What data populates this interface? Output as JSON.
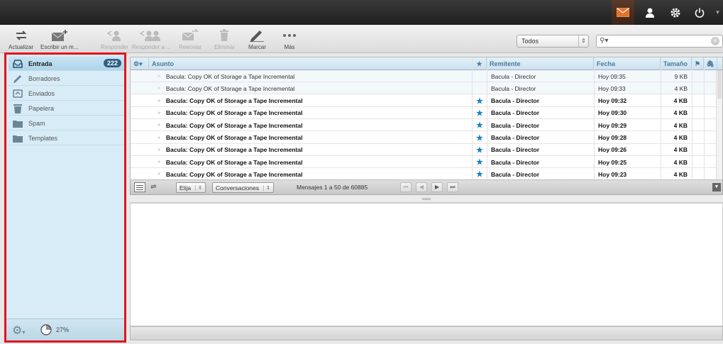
{
  "topbar": {
    "icons": [
      "mail-icon",
      "user-icon",
      "gear-icon",
      "power-icon"
    ],
    "menu_arrow": "▾"
  },
  "toolbar": {
    "buttons": [
      {
        "label": "Actualizar",
        "icon": "refresh-icon",
        "enabled": true
      },
      {
        "label": "Escribir un m...",
        "icon": "compose-icon",
        "enabled": true
      },
      {
        "label": "Responder",
        "icon": "reply-icon",
        "enabled": false
      },
      {
        "label": "Responder a ...",
        "icon": "reply-all-icon",
        "enabled": false
      },
      {
        "label": "Reenviar",
        "icon": "forward-icon",
        "enabled": false
      },
      {
        "label": "Eliminar",
        "icon": "trash-icon",
        "enabled": false
      },
      {
        "label": "Marcar",
        "icon": "mark-icon",
        "enabled": true
      },
      {
        "label": "Más",
        "icon": "more-icon",
        "enabled": true
      }
    ],
    "filter": {
      "value": "Todos"
    },
    "search": {
      "placeholder": "",
      "value": ""
    }
  },
  "folders": {
    "items": [
      {
        "label": "Entrada",
        "icon": "inbox-icon",
        "count": "222",
        "selected": true
      },
      {
        "label": "Borradores",
        "icon": "drafts-icon",
        "count": "",
        "selected": false
      },
      {
        "label": "Enviados",
        "icon": "sent-icon",
        "count": "",
        "selected": false
      },
      {
        "label": "Papelera",
        "icon": "trash-icon",
        "count": "",
        "selected": false
      },
      {
        "label": "Spam",
        "icon": "folder-icon",
        "count": "",
        "selected": false
      },
      {
        "label": "Templates",
        "icon": "folder-icon",
        "count": "",
        "selected": false
      }
    ],
    "quota": "27%"
  },
  "message_list": {
    "columns": {
      "subject": "Asunto",
      "from": "Remitente",
      "date": "Fecha",
      "size": "Tamaño"
    },
    "rows": [
      {
        "subject": "Bacula: Copy OK of Storage a Tape Incremental",
        "from": "Bacula - Director",
        "date": "Hoy 09:35",
        "size": "9 KB",
        "unread": false,
        "flagged": false
      },
      {
        "subject": "Bacula: Copy OK of Storage a Tape Incremental",
        "from": "Bacula - Director",
        "date": "Hoy 09:33",
        "size": "4 KB",
        "unread": false,
        "flagged": false
      },
      {
        "subject": "Bacula: Copy OK of Storage a Tape Incremental",
        "from": "Bacula - Director",
        "date": "Hoy 09:32",
        "size": "4 KB",
        "unread": true,
        "flagged": true
      },
      {
        "subject": "Bacula: Copy OK of Storage a Tape Incremental",
        "from": "Bacula - Director",
        "date": "Hoy 09:30",
        "size": "4 KB",
        "unread": true,
        "flagged": true
      },
      {
        "subject": "Bacula: Copy OK of Storage a Tape Incremental",
        "from": "Bacula - Director",
        "date": "Hoy 09:29",
        "size": "4 KB",
        "unread": true,
        "flagged": true
      },
      {
        "subject": "Bacula: Copy OK of Storage a Tape Incremental",
        "from": "Bacula - Director",
        "date": "Hoy 09:28",
        "size": "4 KB",
        "unread": true,
        "flagged": true
      },
      {
        "subject": "Bacula: Copy OK of Storage a Tape Incremental",
        "from": "Bacula - Director",
        "date": "Hoy 09:26",
        "size": "4 KB",
        "unread": true,
        "flagged": true
      },
      {
        "subject": "Bacula: Copy OK of Storage a Tape Incremental",
        "from": "Bacula - Director",
        "date": "Hoy 09:25",
        "size": "4 KB",
        "unread": true,
        "flagged": true
      },
      {
        "subject": "Bacula: Copy OK of Storage a Tape Incremental",
        "from": "Bacula - Director",
        "date": "Hoy 09:23",
        "size": "4 KB",
        "unread": true,
        "flagged": true
      }
    ]
  },
  "pager": {
    "select": "Elija",
    "view": "Conversaciones",
    "count_text": "Mensajes 1 a 50 de 60885"
  },
  "colors": {
    "accent": "#1c7fc0",
    "highlight_border": "#e2141b",
    "folder_bg": "#d7ecf7"
  }
}
